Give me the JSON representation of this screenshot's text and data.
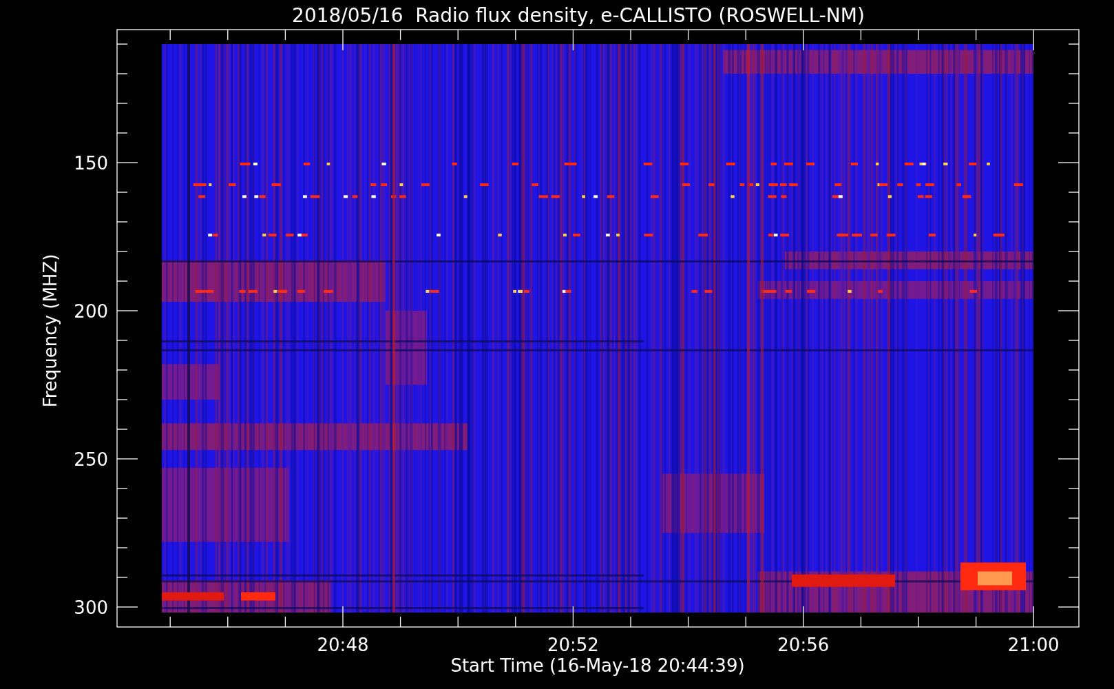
{
  "title": "2018/05/16  Radio flux density, e-CALLISTO (ROSWELL-NM)",
  "y_axis": {
    "label": "Frequency (MHZ)",
    "ticks": [
      "150",
      "200",
      "250",
      "300"
    ]
  },
  "x_axis": {
    "label": "Start Time (16-May-18 20:44:39)",
    "ticks": [
      "20:48",
      "20:52",
      "20:56",
      "21:00"
    ]
  }
}
